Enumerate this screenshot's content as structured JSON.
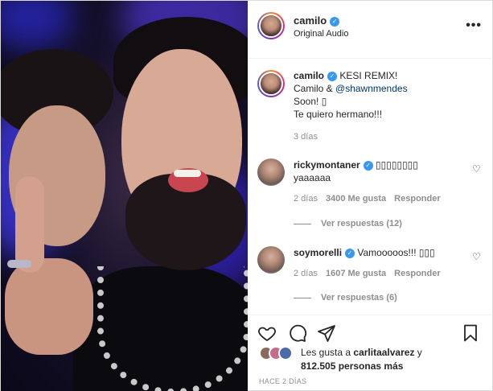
{
  "header": {
    "username": "camilo",
    "subtitle": "Original Audio",
    "more_label": "•••"
  },
  "caption": {
    "username": "camilo",
    "line1": "KESI REMIX!",
    "line2_prefix": "Camilo & ",
    "line2_mention": "@shawnmendes",
    "line3": "Soon! ",
    "line3_glyph": "▯",
    "line4": "Te quiero hermano!!!",
    "time": "3 días"
  },
  "comments": [
    {
      "username": "rickymontaner",
      "text_inline": "▯▯▯▯▯▯▯▯",
      "text_line2": "yaaaaaa",
      "time": "2 días",
      "likes": "3400 Me gusta",
      "reply": "Responder",
      "view_replies": "Ver respuestas (12)"
    },
    {
      "username": "soymorelli",
      "text_inline": "Vamooooos!!! ▯▯▯",
      "time": "2 días",
      "likes": "1607 Me gusta",
      "reply": "Responder",
      "view_replies": "Ver respuestas (6)"
    }
  ],
  "likes": {
    "prefix": "Les gusta a ",
    "user": "carlitaalvarez",
    "mid": " y",
    "count": "812.505 personas más"
  },
  "posted_ago": "HACE 2 DÍAS",
  "icons": {
    "verified": "✓",
    "heart": "♡"
  },
  "colors": {
    "verified": "#3897f0",
    "mention": "#00376b",
    "muted": "#8e8e8e"
  }
}
